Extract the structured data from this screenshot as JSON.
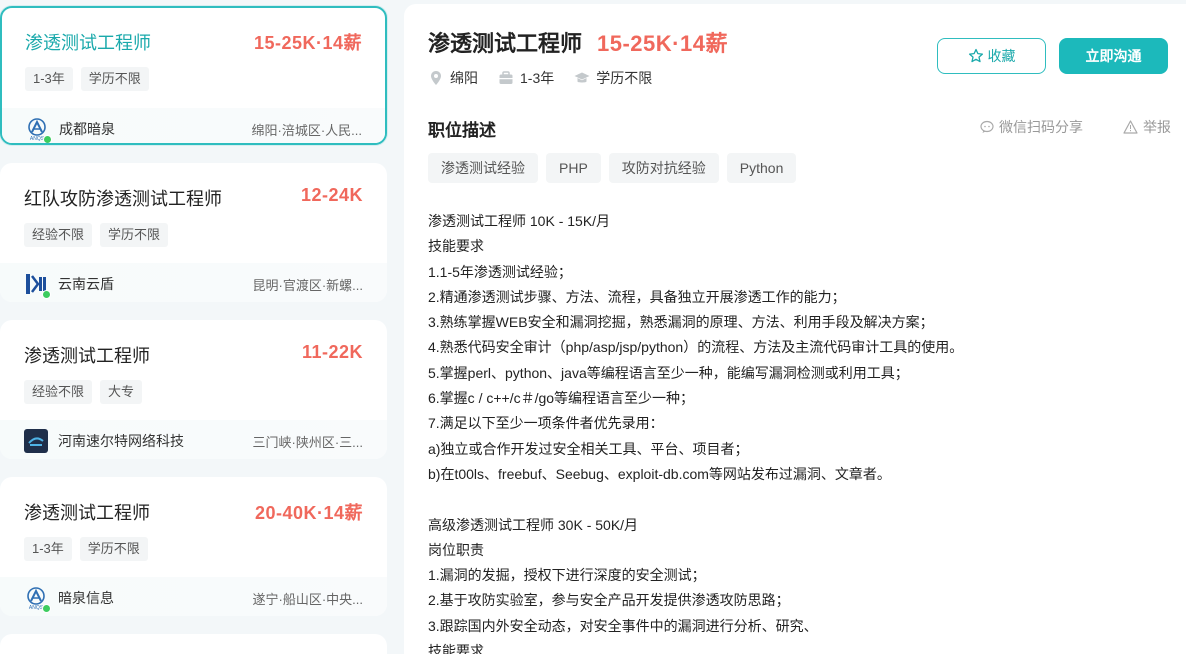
{
  "job_list": [
    {
      "title": "渗透测试工程师",
      "salary": "15-25K·14薪",
      "tags": [
        "1-3年",
        "学历不限"
      ],
      "company": "成都暗泉",
      "location": "绵阳·涪城区·人民...",
      "logo": "anquan-logo",
      "active": true
    },
    {
      "title": "红队攻防渗透测试工程师",
      "salary": "12-24K",
      "tags": [
        "经验不限",
        "学历不限"
      ],
      "company": "云南云盾",
      "location": "昆明·官渡区·新螺...",
      "logo": "yundun-logo",
      "active": false
    },
    {
      "title": "渗透测试工程师",
      "salary": "11-22K",
      "tags": [
        "经验不限",
        "大专"
      ],
      "company": "河南速尔特网络科技",
      "location": "三门峡·陕州区·三...",
      "logo": "suerte-logo",
      "active": false
    },
    {
      "title": "渗透测试工程师",
      "salary": "20-40K·14薪",
      "tags": [
        "1-3年",
        "学历不限"
      ],
      "company": "暗泉信息",
      "location": "遂宁·船山区·中央...",
      "logo": "anquan-logo",
      "active": false
    }
  ],
  "detail": {
    "title": "渗透测试工程师",
    "salary": "15-25K·14薪",
    "meta": {
      "city": "绵阳",
      "experience": "1-3年",
      "education": "学历不限"
    },
    "fav_label": "收藏",
    "chat_label": "立即沟通",
    "section_title": "职位描述",
    "share_label": "微信扫码分享",
    "report_label": "举报",
    "skills": [
      "渗透测试经验",
      "PHP",
      "攻防对抗经验",
      "Python"
    ],
    "description_lines": [
      "渗透测试工程师 10K - 15K/月",
      "技能要求",
      "1.1-5年渗透测试经验；",
      "2.精通渗透测试步骤、方法、流程，具备独立开展渗透工作的能力；",
      "3.熟练掌握WEB安全和漏洞挖掘，熟悉漏洞的原理、方法、利用手段及解决方案；",
      "4.熟悉代码安全审计（php/asp/jsp/python）的流程、方法及主流代码审计工具的使用。",
      "5.掌握perl、python、java等编程语言至少一种，能编写漏洞检测或利用工具；",
      "6.掌握c / c++/c＃/go等编程语言至少一种；",
      "7.满足以下至少一项条件者优先录用：",
      "a)独立或合作开发过安全相关工具、平台、项目者；",
      "b)在t00ls、freebuf、Seebug、exploit-db.com等网站发布过漏洞、文章者。",
      "",
      "高级渗透测试工程师 30K - 50K/月",
      "岗位职责",
      "1.漏洞的发掘，授权下进行深度的安全测试；",
      "2.基于攻防实验室，参与安全产品开发提供渗透攻防思路；",
      "3.跟踪国内外安全动态，对安全事件中的漏洞进行分析、研究、",
      "技能要求"
    ]
  },
  "colors": {
    "accent": "#1cb9bb",
    "salary": "#f0685c",
    "online": "#3dcc5f"
  }
}
